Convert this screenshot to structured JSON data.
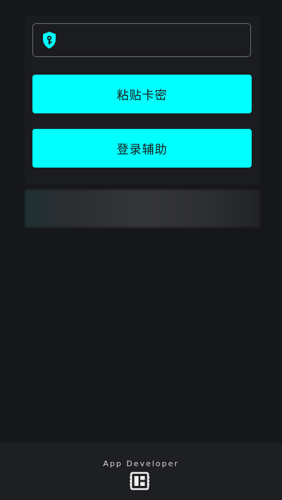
{
  "login": {
    "key_value": "",
    "key_placeholder": "",
    "paste_button_label": "粘贴卡密",
    "login_button_label": "登录辅助"
  },
  "notice": {
    "text": ""
  },
  "footer": {
    "developer_label": "App Developer"
  },
  "colors": {
    "accent": "#00ffff",
    "background": "#16171a",
    "card": "#1b1c1f",
    "footer": "#1e1f22"
  },
  "icons": {
    "key_field_icon": "shield-key-icon",
    "developer_icon": "developer-board-icon"
  }
}
